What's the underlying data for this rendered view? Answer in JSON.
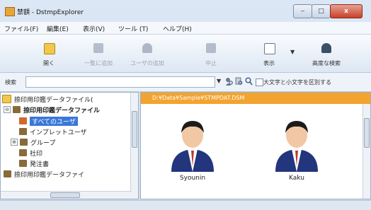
{
  "window": {
    "title": "禁額 - DstmpExplorer",
    "min_label": "‒",
    "max_label": "□",
    "close_label": "x"
  },
  "menu": [
    "ファイル(F)",
    "編集(E)",
    "表示(V)",
    "ツール (T)",
    "ヘルプ(H)"
  ],
  "toolbar": [
    {
      "label": "開く",
      "icon": "folder-icon",
      "enabled": true
    },
    {
      "label": "一覧に追加",
      "icon": "list-add-icon",
      "enabled": false
    },
    {
      "label": "ユーザの追加",
      "icon": "user-add-icon",
      "enabled": false
    },
    {
      "label": "中止",
      "icon": "stop-icon",
      "enabled": false
    },
    {
      "label": "表示",
      "icon": "view-icon",
      "enabled": true
    },
    {
      "label": "高度な検索",
      "icon": "advanced-search-icon",
      "enabled": true
    }
  ],
  "search": {
    "label": "検索",
    "placeholder": "",
    "checkbox_label": "大文字と小文字を区別する"
  },
  "tree": {
    "items": [
      {
        "label": "捺印用印鑑データファイル(",
        "level": 0,
        "icon": "folder-icon"
      },
      {
        "label": "捺印用印鑑データファイル",
        "level": 1,
        "icon": "database-icon",
        "expander": "⊖"
      },
      {
        "label": "すべてのユーザ",
        "level": 2,
        "icon": "users-icon",
        "selected": true
      },
      {
        "label": "インプレットユーザ",
        "level": 2,
        "icon": "user-icon"
      },
      {
        "label": "グループ",
        "level": 2,
        "icon": "group-icon",
        "expander": "⊕"
      },
      {
        "label": "社印",
        "level": 2,
        "icon": "seal-icon"
      },
      {
        "label": "発注書",
        "level": 2,
        "icon": "document-icon"
      },
      {
        "label": "捺印用印鑑データファイ",
        "level": 1,
        "icon": "database-icon"
      }
    ]
  },
  "list": {
    "path": "D:¥Data¥Sample¥STMPDAT.DSM",
    "users": [
      {
        "name": "Syounin"
      },
      {
        "name": "Kaku"
      }
    ]
  },
  "colors": {
    "accent": "#f3a32f",
    "selection": "#3a77d8"
  }
}
